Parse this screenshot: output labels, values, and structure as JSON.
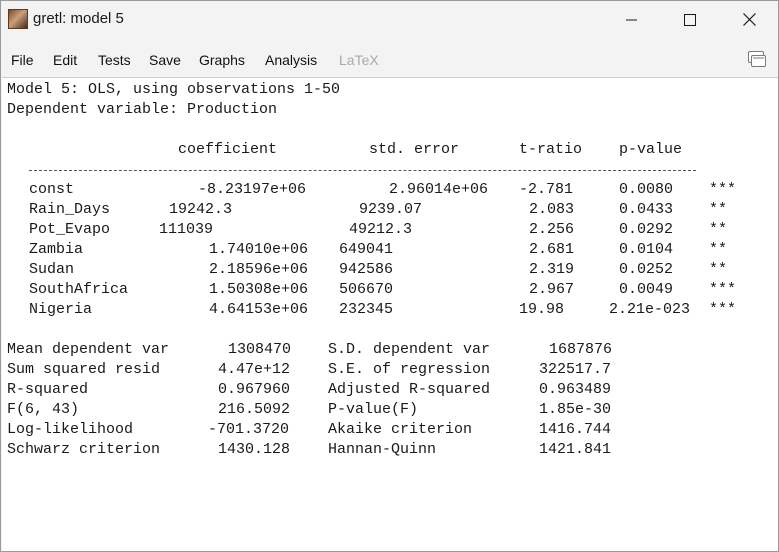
{
  "window": {
    "title": "gretl: model 5"
  },
  "menu": [
    "File",
    "Edit",
    "Tests",
    "Save",
    "Graphs",
    "Analysis",
    "LaTeX"
  ],
  "icons": {
    "app": "gretl-app-icon",
    "minimize": "minimize-icon",
    "maximize": "maximize-icon",
    "close": "close-icon",
    "toolbar": "copy-windows-icon"
  },
  "output": {
    "header1": "Model 5: OLS, using observations 1-50",
    "header2": "Dependent variable: Production",
    "columns": {
      "coef": "coefficient",
      "se": "std. error",
      "t": "t-ratio",
      "p": "p-value"
    },
    "rows": [
      {
        "name": "const",
        "coef": "-8.23197e+06",
        "se": "2.96014e+06",
        "t": "-2.781",
        "p": "0.0080",
        "stars": "***"
      },
      {
        "name": "Rain_Days",
        "coef": "19242.3",
        "se": "9239.07",
        "t": "2.083",
        "p": "0.0433",
        "stars": "**"
      },
      {
        "name": "Pot_Evapo",
        "coef": "111039",
        "se": "49212.3",
        "t": "2.256",
        "p": "0.0292",
        "stars": "**"
      },
      {
        "name": "Zambia",
        "coef": "1.74010e+06",
        "se": "649041",
        "t": "2.681",
        "p": "0.0104",
        "stars": "**"
      },
      {
        "name": "Sudan",
        "coef": "2.18596e+06",
        "se": "942586",
        "t": "2.319",
        "p": "0.0252",
        "stars": "**"
      },
      {
        "name": "SouthAfrica",
        "coef": "1.50308e+06",
        "se": "506670",
        "t": "2.967",
        "p": "0.0049",
        "stars": "***"
      },
      {
        "name": "Nigeria",
        "coef": "4.64153e+06",
        "se": "232345",
        "t": "19.98",
        "p": "2.21e-023",
        "stars": "***"
      }
    ],
    "stats": [
      {
        "l": "Mean dependent var",
        "lv": "1308470",
        "r": "S.D. dependent var",
        "rv": "1687876"
      },
      {
        "l": "Sum squared resid",
        "lv": "4.47e+12",
        "r": "S.E. of regression",
        "rv": "322517.7"
      },
      {
        "l": "R-squared",
        "lv": "0.967960",
        "r": "Adjusted R-squared",
        "rv": "0.963489"
      },
      {
        "l": "F(6, 43)",
        "lv": "216.5092",
        "r": "P-value(F)",
        "rv": "1.85e-30"
      },
      {
        "l": "Log-likelihood",
        "lv": "-701.3720",
        "r": "Akaike criterion",
        "rv": "1416.744"
      },
      {
        "l": "Schwarz criterion",
        "lv": "1430.128",
        "r": "Hannan-Quinn",
        "rv": "1421.841"
      }
    ]
  }
}
